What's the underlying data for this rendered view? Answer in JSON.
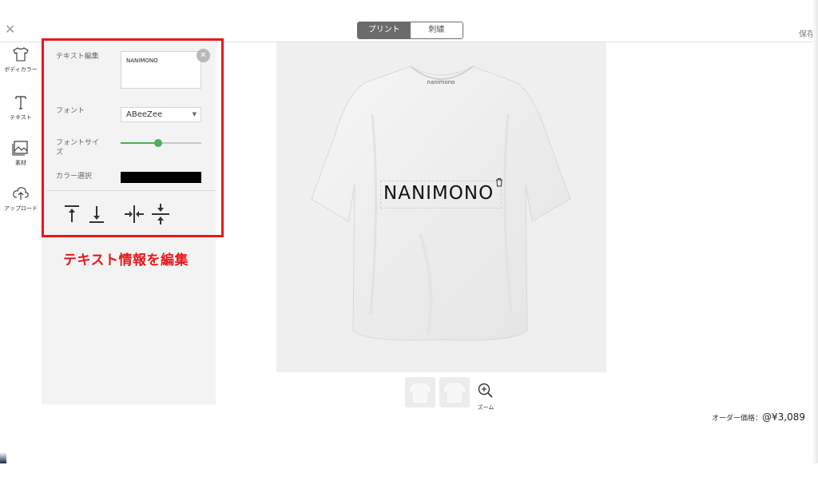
{
  "topbar": {
    "close_icon": "close-icon",
    "mode_tabs": [
      {
        "label": "プリント",
        "active": true
      },
      {
        "label": "刺繍",
        "active": false
      }
    ],
    "save_label": "保存"
  },
  "rail": {
    "items": [
      {
        "label": "ボディカラー",
        "icon": "tshirt-icon"
      },
      {
        "label": "テキスト",
        "icon": "text-icon"
      },
      {
        "label": "素材",
        "icon": "image-icon"
      },
      {
        "label": "アップロード",
        "icon": "upload-cloud-icon"
      }
    ]
  },
  "panel": {
    "text_edit_label": "テキスト編集",
    "text_value": "NANIMONO",
    "font_label": "フォント",
    "font_value": "ABeeZee",
    "font_size_label": "フォントサイズ",
    "font_size_fraction": 0.47,
    "color_label": "カラー選択",
    "color_value": "#000000",
    "tools": [
      "align-top-icon",
      "align-bottom-icon",
      "center-horizontal-icon",
      "center-vertical-icon"
    ]
  },
  "caption": "テキスト情報を編集",
  "canvas": {
    "shirt_tag": "nanimono",
    "design_text": "NANIMONO"
  },
  "zoom_label": "ズーム",
  "price": {
    "label": "オーダー価格：",
    "value": "@¥3,089"
  },
  "colors": {
    "highlight": "#e8171d",
    "slider": "#4cae5a",
    "tab_active": "#6b6b6b"
  }
}
